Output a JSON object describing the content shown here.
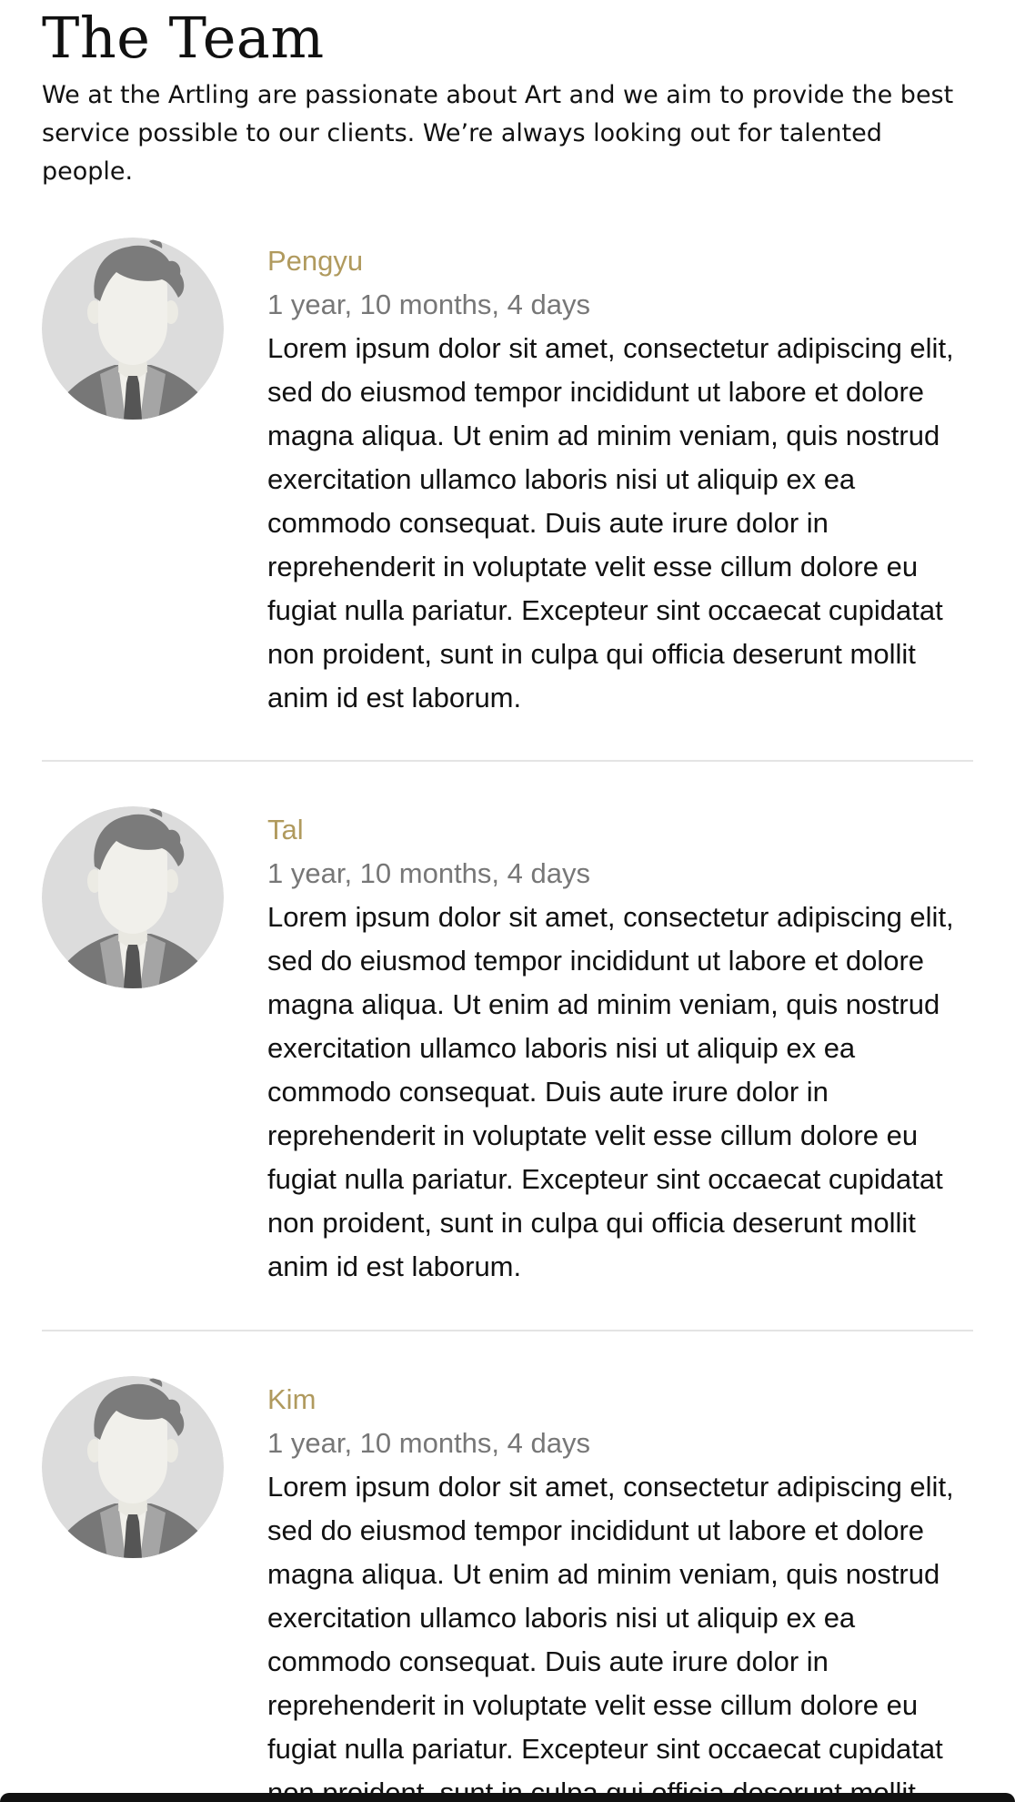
{
  "page": {
    "title": "The Team",
    "intro": "We at the Artling are passionate about Art and we aim to provide the best service possible to our clients. We’re always looking out for talented people."
  },
  "colors": {
    "accent": "#b09a5e",
    "muted": "#777777",
    "divider": "#e4e4e4",
    "avatar_bg": "#dcdcdc"
  },
  "team": [
    {
      "avatar_icon": "person-avatar-icon",
      "name": "Pengyu",
      "tenure": "1 year, 10 months, 4 days",
      "bio": "Lorem ipsum dolor sit amet, consectetur adipiscing elit, sed do eiusmod tempor incididunt ut labore et dolore magna aliqua. Ut enim ad minim veniam, quis nostrud exercitation ullamco laboris nisi ut aliquip ex ea commodo consequat. Duis aute irure dolor in reprehenderit in voluptate velit esse cillum dolore eu fugiat nulla pariatur. Excepteur sint occaecat cupidatat non proident, sunt in culpa qui officia deserunt mollit anim id est laborum."
    },
    {
      "avatar_icon": "person-avatar-icon",
      "name": "Tal",
      "tenure": "1 year, 10 months, 4 days",
      "bio": "Lorem ipsum dolor sit amet, consectetur adipiscing elit, sed do eiusmod tempor incididunt ut labore et dolore magna aliqua. Ut enim ad minim veniam, quis nostrud exercitation ullamco laboris nisi ut aliquip ex ea commodo consequat. Duis aute irure dolor in reprehenderit in voluptate velit esse cillum dolore eu fugiat nulla pariatur. Excepteur sint occaecat cupidatat non proident, sunt in culpa qui officia deserunt mollit anim id est laborum."
    },
    {
      "avatar_icon": "person-avatar-icon",
      "name": "Kim",
      "tenure": "1 year, 10 months, 4 days",
      "bio": "Lorem ipsum dolor sit amet, consectetur adipiscing elit, sed do eiusmod tempor incididunt ut labore et dolore magna aliqua. Ut enim ad minim veniam, quis nostrud exercitation ullamco laboris nisi ut aliquip ex ea commodo consequat. Duis aute irure dolor in reprehenderit in voluptate velit esse cillum dolore eu fugiat nulla pariatur. Excepteur sint occaecat cupidatat non proident, sunt in culpa qui officia deserunt mollit anim id est laborum."
    }
  ]
}
